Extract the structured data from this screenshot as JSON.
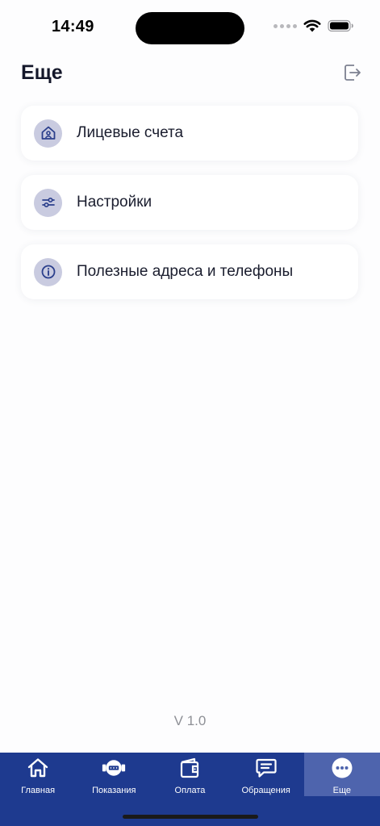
{
  "status_bar": {
    "time": "14:49"
  },
  "header": {
    "title": "Еще"
  },
  "menu": {
    "items": [
      {
        "label": "Лицевые счета",
        "icon": "house-account-icon"
      },
      {
        "label": "Настройки",
        "icon": "sliders-icon"
      },
      {
        "label": "Полезные адреса и телефоны",
        "icon": "info-icon"
      }
    ]
  },
  "version": "V 1.0",
  "tabs": [
    {
      "label": "Главная",
      "icon": "home-icon",
      "active": false
    },
    {
      "label": "Показания",
      "icon": "meter-icon",
      "active": false
    },
    {
      "label": "Оплата",
      "icon": "wallet-icon",
      "active": false
    },
    {
      "label": "Обращения",
      "icon": "message-icon",
      "active": false
    },
    {
      "label": "Еще",
      "icon": "more-icon",
      "active": true
    }
  ],
  "colors": {
    "tab_bar": "#1e3a8f",
    "tab_active": "#4e64ad",
    "icon_circle": "#c9cbe0",
    "icon_stroke": "#2b3f8c"
  }
}
